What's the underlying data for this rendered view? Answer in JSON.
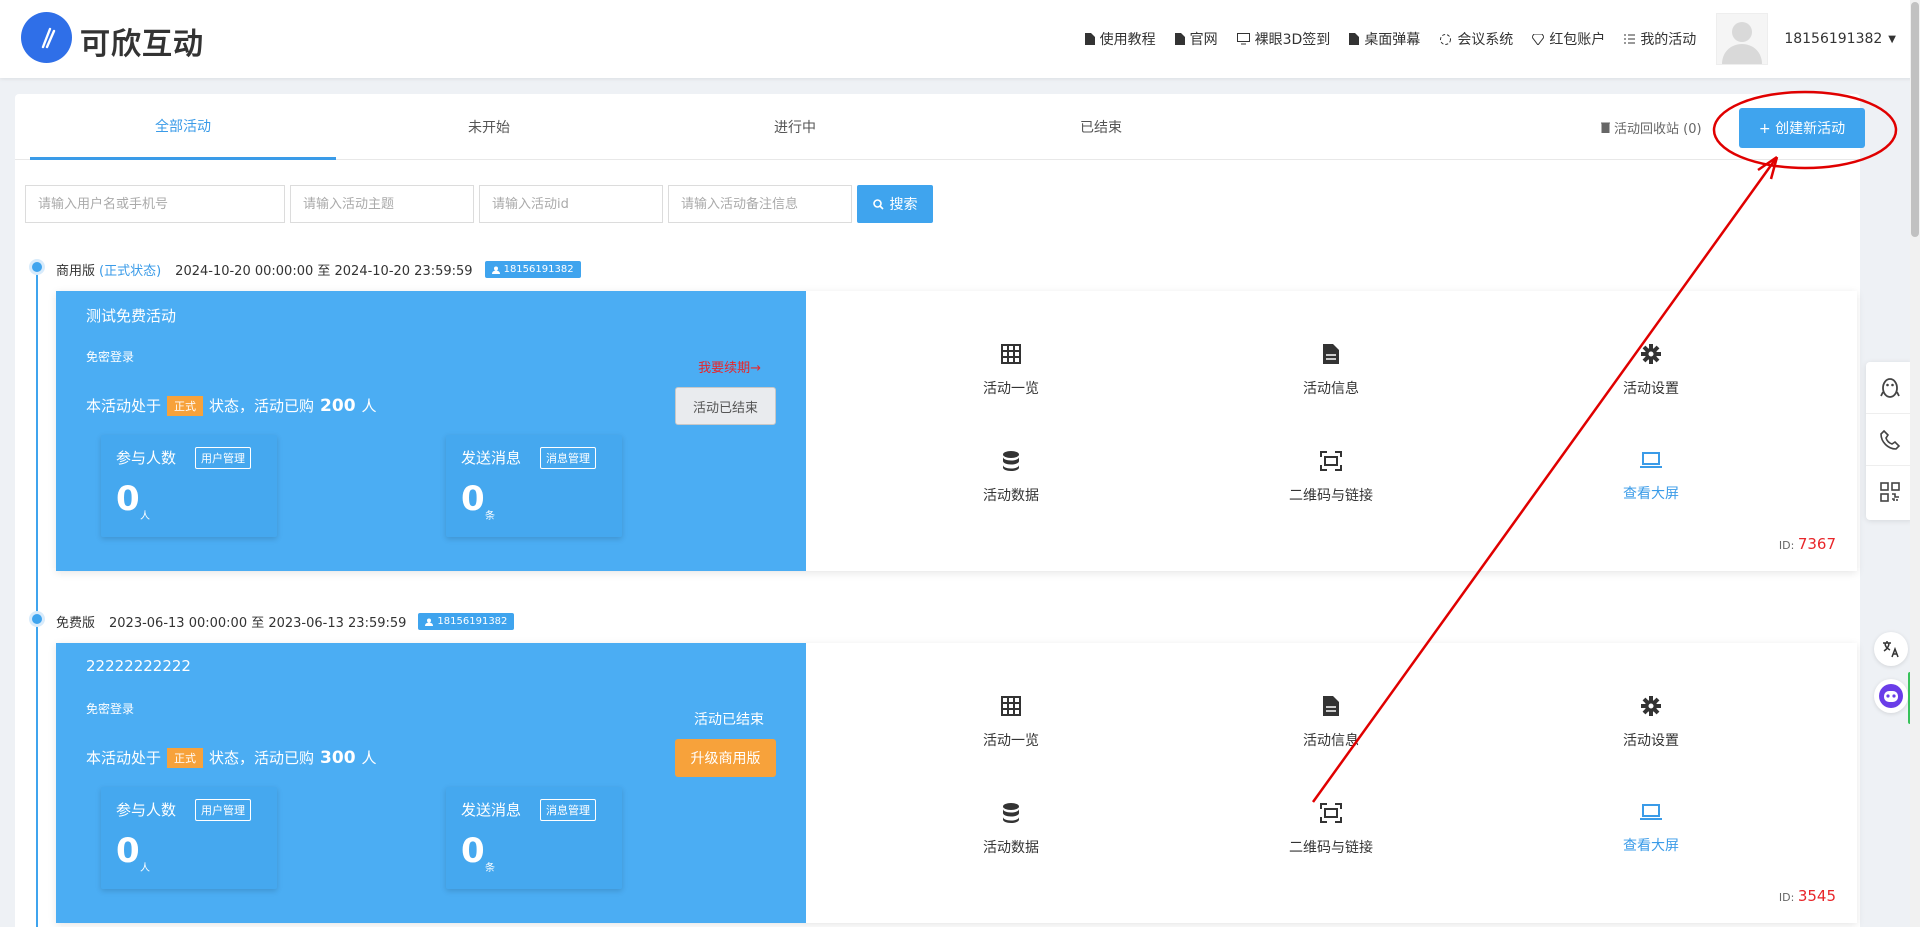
{
  "header": {
    "brand": "可欣互动",
    "nav": [
      {
        "label": "使用教程",
        "icon": "document-icon"
      },
      {
        "label": "官网",
        "icon": "document-icon"
      },
      {
        "label": "裸眼3D签到",
        "icon": "monitor-icon"
      },
      {
        "label": "桌面弹幕",
        "icon": "document-icon"
      },
      {
        "label": "会议系统",
        "icon": "meeting-icon"
      },
      {
        "label": "红包账户",
        "icon": "diamond-icon"
      },
      {
        "label": "我的活动",
        "icon": "list-icon"
      }
    ],
    "user_phone": "18156191382"
  },
  "tabs": [
    "全部活动",
    "未开始",
    "进行中",
    "已结束"
  ],
  "active_tab": "全部活动",
  "recycle_label": "活动回收站 (0)",
  "create_button": "+ 创建新活动",
  "search": {
    "user_placeholder": "请输入用户名或手机号",
    "topic_placeholder": "请输入活动主题",
    "id_placeholder": "请输入活动id",
    "note_placeholder": "请输入活动备注信息",
    "button": "搜索"
  },
  "activities": [
    {
      "edition": "商用版",
      "status": "(正式状态)",
      "dates": "2024-10-20 00:00:00 至 2024-10-20 23:59:59",
      "user": "18156191382",
      "title": "测试免费活动",
      "login_mode": "免密登录",
      "state_prefix": "本活动处于",
      "state_badge": "正式",
      "state_mid": "状态，活动已购",
      "purchased": "200",
      "state_suffix": "人",
      "renew_link": "我要续期→",
      "action_button": "活动已结束",
      "participants_label": "参与人数",
      "participants_btn": "用户管理",
      "participants_value": "0",
      "participants_unit": "人",
      "messages_label": "发送消息",
      "messages_btn": "消息管理",
      "messages_value": "0",
      "messages_unit": "条",
      "functions": [
        "活动一览",
        "活动信息",
        "活动设置",
        "活动数据",
        "二维码与链接",
        "查看大屏"
      ],
      "id_label": "ID:",
      "id": "7367"
    },
    {
      "edition": "免费版",
      "dates": "2023-06-13 00:00:00 至 2023-06-13 23:59:59",
      "user": "18156191382",
      "title": "22222222222",
      "login_mode": "免密登录",
      "state_prefix": "本活动处于",
      "state_badge": "正式",
      "state_mid": "状态，活动已购",
      "purchased": "300",
      "state_suffix": "人",
      "ended_text": "活动已结束",
      "action_button": "升级商用版",
      "participants_label": "参与人数",
      "participants_btn": "用户管理",
      "participants_value": "0",
      "participants_unit": "人",
      "messages_label": "发送消息",
      "messages_btn": "消息管理",
      "messages_value": "0",
      "messages_unit": "条",
      "functions": [
        "活动一览",
        "活动信息",
        "活动设置",
        "活动数据",
        "二维码与链接",
        "查看大屏"
      ],
      "id_label": "ID:",
      "id": "3545"
    }
  ],
  "colors": {
    "primary": "#3fa4ee",
    "card_blue": "#4badf3",
    "orange": "#f7a23b",
    "red": "#e8262a",
    "annotation": "#e00000"
  }
}
